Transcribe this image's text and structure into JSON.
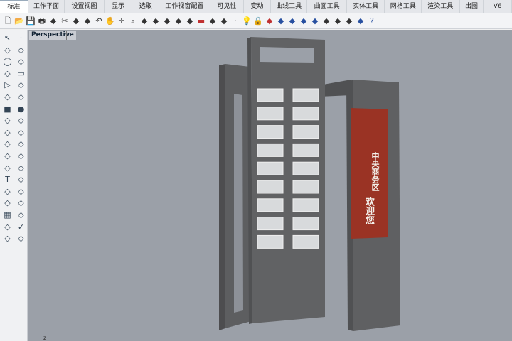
{
  "tabs": [
    "标准",
    "工作平面",
    "设置视图",
    "显示",
    "选取",
    "工作视窗配置",
    "可见性",
    "变动",
    "曲线工具",
    "曲面工具",
    "实体工具",
    "网格工具",
    "渲染工具",
    "出图",
    "V6"
  ],
  "active_tab": "标准",
  "toolbar_icons": [
    "new-icon",
    "open-icon",
    "save-icon",
    "print-icon",
    "copy-to-clipboard-icon",
    "cut-icon",
    "copy-icon",
    "paste-icon",
    "undo-icon",
    "pan-icon",
    "rotate-view-icon",
    "zoom-icon",
    "zoom-window-icon",
    "zoom-extents-icon",
    "zoom-selected-icon",
    "undo-view-icon",
    "viewport-layout-icon",
    "car-icon",
    "named-view-icon",
    "plane-icon",
    "point-icon",
    "light-icon",
    "lock-icon",
    "layer-icon",
    "color-wheel-icon",
    "material-icon",
    "render-sphere-icon",
    "blue-sphere-icon",
    "filter-icon",
    "options-gear-icon",
    "group-icon",
    "globe-icon",
    "help-icon"
  ],
  "left_tools": [
    "select-icon",
    "point-icon",
    "polyline-icon",
    "curve-icon",
    "circle-icon",
    "ellipse-icon",
    "arc-icon",
    "rectangle-icon",
    "polygon-icon",
    "fillet-icon",
    "surface-icon",
    "loft-icon",
    "box-icon",
    "sphere-icon",
    "cylinder-icon",
    "plane-surface-icon",
    "boolean-icon",
    "explode-icon",
    "trim-icon",
    "split-icon",
    "join-icon",
    "group-icon",
    "offset-icon",
    "extend-icon",
    "text-icon",
    "dimension-icon",
    "array-icon",
    "mirror-icon",
    "extrude-icon",
    "project-icon",
    "grid-icon",
    "gumball-icon",
    "scale-icon",
    "check-icon",
    "solid-icon",
    "render-icon"
  ],
  "viewport": {
    "title": "Perspective",
    "background": "#9ba0a8"
  },
  "sign": {
    "line1": "中央商务区",
    "line2": "欢迎您",
    "color": "#9a3324"
  },
  "axis_label": "z"
}
